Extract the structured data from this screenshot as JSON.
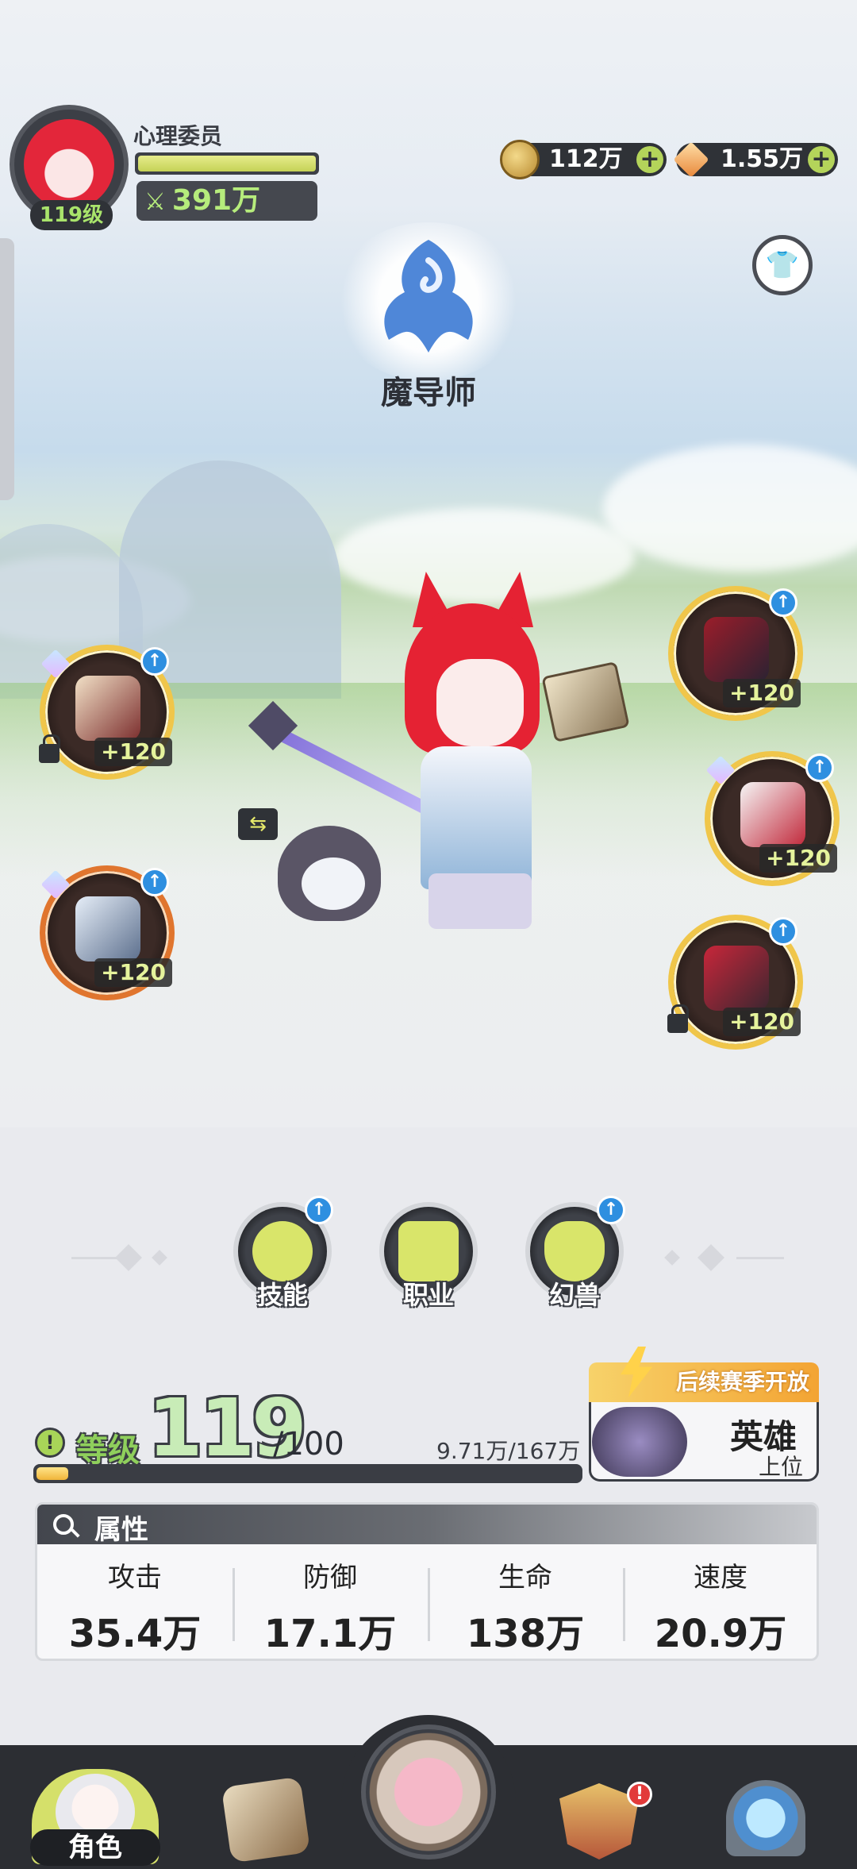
{
  "player": {
    "name": "心理委员",
    "level_badge": "119级",
    "power": "391万"
  },
  "currencies": [
    {
      "icon": "gold-coin-icon",
      "value": "112万"
    },
    {
      "icon": "diamond-gem-icon",
      "value": "1.55万"
    }
  ],
  "class": {
    "name": "魔导师"
  },
  "equipment": {
    "left": [
      {
        "name": "weapon-bracelet",
        "level": "+120",
        "locked": true
      },
      {
        "name": "tome",
        "level": "+120",
        "locked": false
      }
    ],
    "right": [
      {
        "name": "belt",
        "level": "+120",
        "locked": false
      },
      {
        "name": "armor",
        "level": "+120",
        "locked": false
      },
      {
        "name": "boots",
        "level": "+120",
        "locked": true
      }
    ]
  },
  "functions": [
    {
      "label": "技能",
      "icon": "skill-icon",
      "upgrade": true
    },
    {
      "label": "职业",
      "icon": "profession-icon",
      "upgrade": false
    },
    {
      "label": "幻兽",
      "icon": "phantom-beast-icon",
      "upgrade": true
    }
  ],
  "level": {
    "label": "等级",
    "current": "119",
    "max": "/100",
    "exp_text": "9.71万/167万",
    "exp_fraction": 0.058
  },
  "rank": {
    "banner": "后续赛季开放",
    "title": "英雄",
    "sub": "上位"
  },
  "attributes": {
    "title": "属性",
    "items": [
      {
        "label": "攻击",
        "value": "35.4万"
      },
      {
        "label": "防御",
        "value": "17.1万"
      },
      {
        "label": "生命",
        "value": "138万"
      },
      {
        "label": "速度",
        "value": "20.9万"
      }
    ]
  },
  "nav": {
    "active_label": "角色",
    "items": [
      "character-icon",
      "quest-book-icon",
      "home-house-icon",
      "guild-shield-icon",
      "portal-gate-icon"
    ]
  },
  "colors": {
    "accent_green": "#b4d45a",
    "slot_gold": "#f0c64a",
    "slot_orange": "#e0752e",
    "upgrade_blue": "#2e8fe0",
    "alert_red": "#e23a3a"
  }
}
